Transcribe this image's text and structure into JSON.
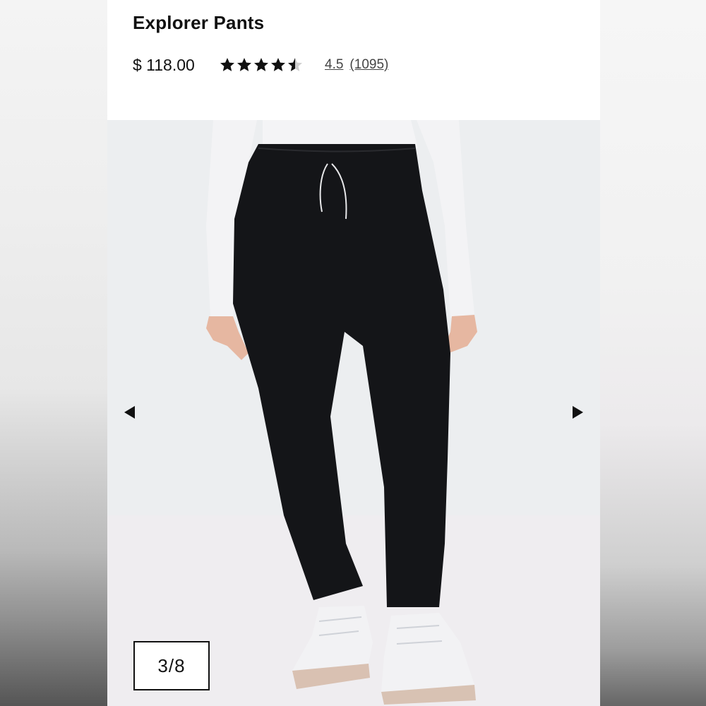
{
  "product": {
    "title": "Explorer Pants",
    "price": "$ 118.00",
    "rating": 4.5,
    "rating_label": "4.5",
    "review_count_label": "(1095)",
    "star_count": 5
  },
  "gallery": {
    "counter": "3/8",
    "current": 3,
    "total": 8,
    "image_alt": "product-photo-black-joggers"
  },
  "colors": {
    "text": "#111111",
    "pants": "#141518",
    "shirt": "#f3f3f5",
    "skin": "#e7b9a3"
  },
  "icons": {
    "prev": "triangle-left",
    "next": "triangle-right",
    "star": "star"
  }
}
